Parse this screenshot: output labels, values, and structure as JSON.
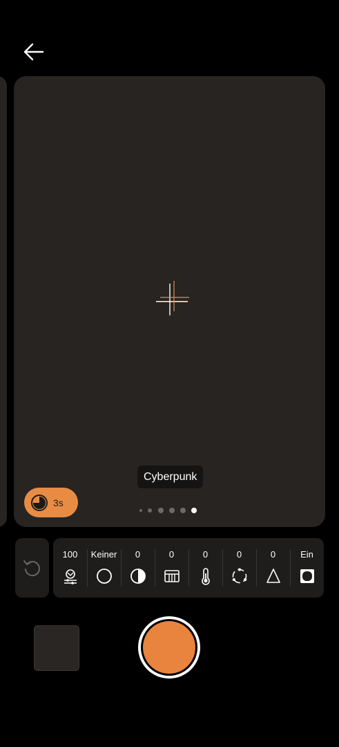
{
  "preview": {
    "filter_name": "Cyberpunk",
    "filter_page": 6,
    "filter_page_count": 6
  },
  "timer": {
    "label": "3s"
  },
  "adjustments": [
    {
      "id": "brightness",
      "value": "100",
      "icon": "brightness-adjust-icon"
    },
    {
      "id": "vignette",
      "value": "Keiner",
      "icon": "circle-outline-icon"
    },
    {
      "id": "contrast",
      "value": "0",
      "icon": "contrast-icon"
    },
    {
      "id": "saturation",
      "value": "0",
      "icon": "grid-frame-icon"
    },
    {
      "id": "temperature",
      "value": "0",
      "icon": "thermometer-icon"
    },
    {
      "id": "tint",
      "value": "0",
      "icon": "dotted-circle-icon"
    },
    {
      "id": "sharpness",
      "value": "0",
      "icon": "triangle-icon"
    },
    {
      "id": "frame",
      "value": "Ein",
      "icon": "rounded-frame-icon"
    }
  ],
  "colors": {
    "accent": "#e98c43",
    "preview_bg": "#272422",
    "panel_bg": "#1f1d1c"
  }
}
